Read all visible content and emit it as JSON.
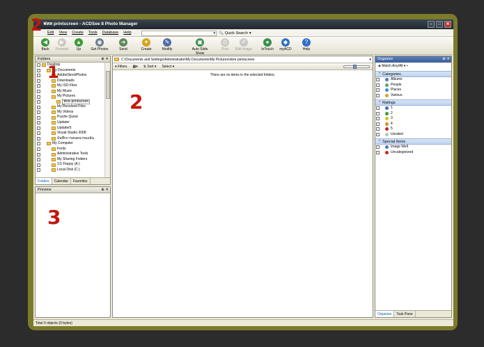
{
  "window": {
    "title": "ฟหห printscreen - ACDSee 8 Photo Manager",
    "btn_min": "–",
    "btn_max": "□",
    "btn_close": "✕"
  },
  "menu": {
    "items": [
      "Edit",
      "View",
      "Create",
      "Tools",
      "Database",
      "Help"
    ],
    "quick_search": "Quick Search"
  },
  "toolbar": {
    "tools": [
      {
        "label": "Back",
        "icon": "back-arrow-icon",
        "color": "#3a9a3a",
        "glyph": "◀",
        "enabled": true
      },
      {
        "label": "Forward",
        "icon": "forward-arrow-icon",
        "color": "#9a9a9a",
        "glyph": "▶",
        "enabled": false
      },
      {
        "label": "Up",
        "icon": "up-arrow-icon",
        "color": "#3a9a3a",
        "glyph": "▲",
        "enabled": true
      },
      {
        "label": "Get Photos",
        "icon": "camera-icon",
        "color": "#6b7d8f",
        "glyph": "◉",
        "enabled": true
      },
      {
        "label": "Send",
        "icon": "send-icon",
        "color": "#5d8a5d",
        "glyph": "➜",
        "enabled": true
      },
      {
        "label": "Create",
        "icon": "wand-icon",
        "color": "#d9a41c",
        "glyph": "✦",
        "enabled": true
      },
      {
        "label": "Modify",
        "icon": "edit-icon",
        "color": "#4f6ea3",
        "glyph": "✎",
        "enabled": true
      },
      {
        "label": "Auto Slide Show",
        "icon": "slideshow-icon",
        "color": "#3f8f5a",
        "glyph": "▣",
        "enabled": true
      },
      {
        "label": "Print",
        "icon": "print-icon",
        "color": "#9a9a9a",
        "glyph": "⎙",
        "enabled": false
      },
      {
        "label": "Edit Image",
        "icon": "edit-image-icon",
        "color": "#9a9a9a",
        "glyph": "✐",
        "enabled": false
      },
      {
        "label": "InTouch",
        "icon": "intouch-icon",
        "color": "#3a8f4d",
        "glyph": "●",
        "enabled": true
      },
      {
        "label": "myACD",
        "icon": "myacd-icon",
        "color": "#2f74c0",
        "glyph": "◆",
        "enabled": true
      },
      {
        "label": "Help",
        "icon": "help-icon",
        "color": "#2f6fc9",
        "glyph": "?",
        "enabled": true
      }
    ]
  },
  "folders_pane": {
    "title": "Folders",
    "tree": [
      {
        "label": "Desktop",
        "indent": 0
      },
      {
        "label": "My Documents",
        "indent": 1
      },
      {
        "label": "AdobeStockPhotos",
        "indent": 2
      },
      {
        "label": "Downloads",
        "indent": 2
      },
      {
        "label": "My ISO Files",
        "indent": 2
      },
      {
        "label": "My Music",
        "indent": 2
      },
      {
        "label": "My Pictures",
        "indent": 2
      },
      {
        "label": "ฟหห printscreen",
        "indent": 3,
        "selected": true
      },
      {
        "label": "My Received Files",
        "indent": 2
      },
      {
        "label": "My Videos",
        "indent": 2
      },
      {
        "label": "Puzzle Quest",
        "indent": 2
      },
      {
        "label": "Updater",
        "indent": 2
      },
      {
        "label": "Updater5",
        "indent": 2
      },
      {
        "label": "Visual Studio 2008",
        "indent": 2
      },
      {
        "label": "บันทึกการสนทนาของฉัน",
        "indent": 2
      },
      {
        "label": "My Computer",
        "indent": 1
      },
      {
        "label": "Fonts",
        "indent": 2
      },
      {
        "label": "Administrative Tools",
        "indent": 2
      },
      {
        "label": "My Sharing Folders",
        "indent": 2
      },
      {
        "label": "3.5 Floppy (A:)",
        "indent": 2
      },
      {
        "label": "Local Disk (C:)",
        "indent": 2
      }
    ],
    "tabs": [
      "Folders",
      "Calendar",
      "Favorites"
    ]
  },
  "preview_pane": {
    "title": "Preview"
  },
  "content": {
    "path": "C:\\Documents and Settings\\Administrator\\My Documents\\My Pictures\\ฟหห printscreen",
    "filters": "Filters",
    "sort": "Sort",
    "select": "Select",
    "empty_message": "There are no items in the selected folders.",
    "zoom_level": 0.4
  },
  "organize_pane": {
    "title": "Organize",
    "match": "Match Any/All",
    "sections": [
      {
        "title": "Categories",
        "items": [
          {
            "label": "Albums",
            "color": "#4a78c4"
          },
          {
            "label": "People",
            "color": "#5fa35f"
          },
          {
            "label": "Places",
            "color": "#3c8fd0"
          },
          {
            "label": "Various",
            "color": "#d9a41c"
          }
        ]
      },
      {
        "title": "Ratings",
        "items": [
          {
            "label": "1",
            "color": "#3d6fc0"
          },
          {
            "label": "2",
            "color": "#3a9a3a"
          },
          {
            "label": "3",
            "color": "#d9c21c"
          },
          {
            "label": "4",
            "color": "#e08a1c"
          },
          {
            "label": "5",
            "color": "#c42a1c"
          },
          {
            "label": "Unrated",
            "color": "#bfbfbf"
          }
        ]
      },
      {
        "title": "Special Items",
        "items": [
          {
            "label": "Image Well",
            "color": "#4a78c4"
          },
          {
            "label": "Uncategorized",
            "color": "#c42a1c"
          }
        ]
      }
    ],
    "tabs": [
      "Organize",
      "Task Pane"
    ]
  },
  "statusbar": {
    "text": "Total 0 objects (0 bytes)"
  },
  "annotations": [
    "2",
    "1",
    "2",
    "3"
  ]
}
